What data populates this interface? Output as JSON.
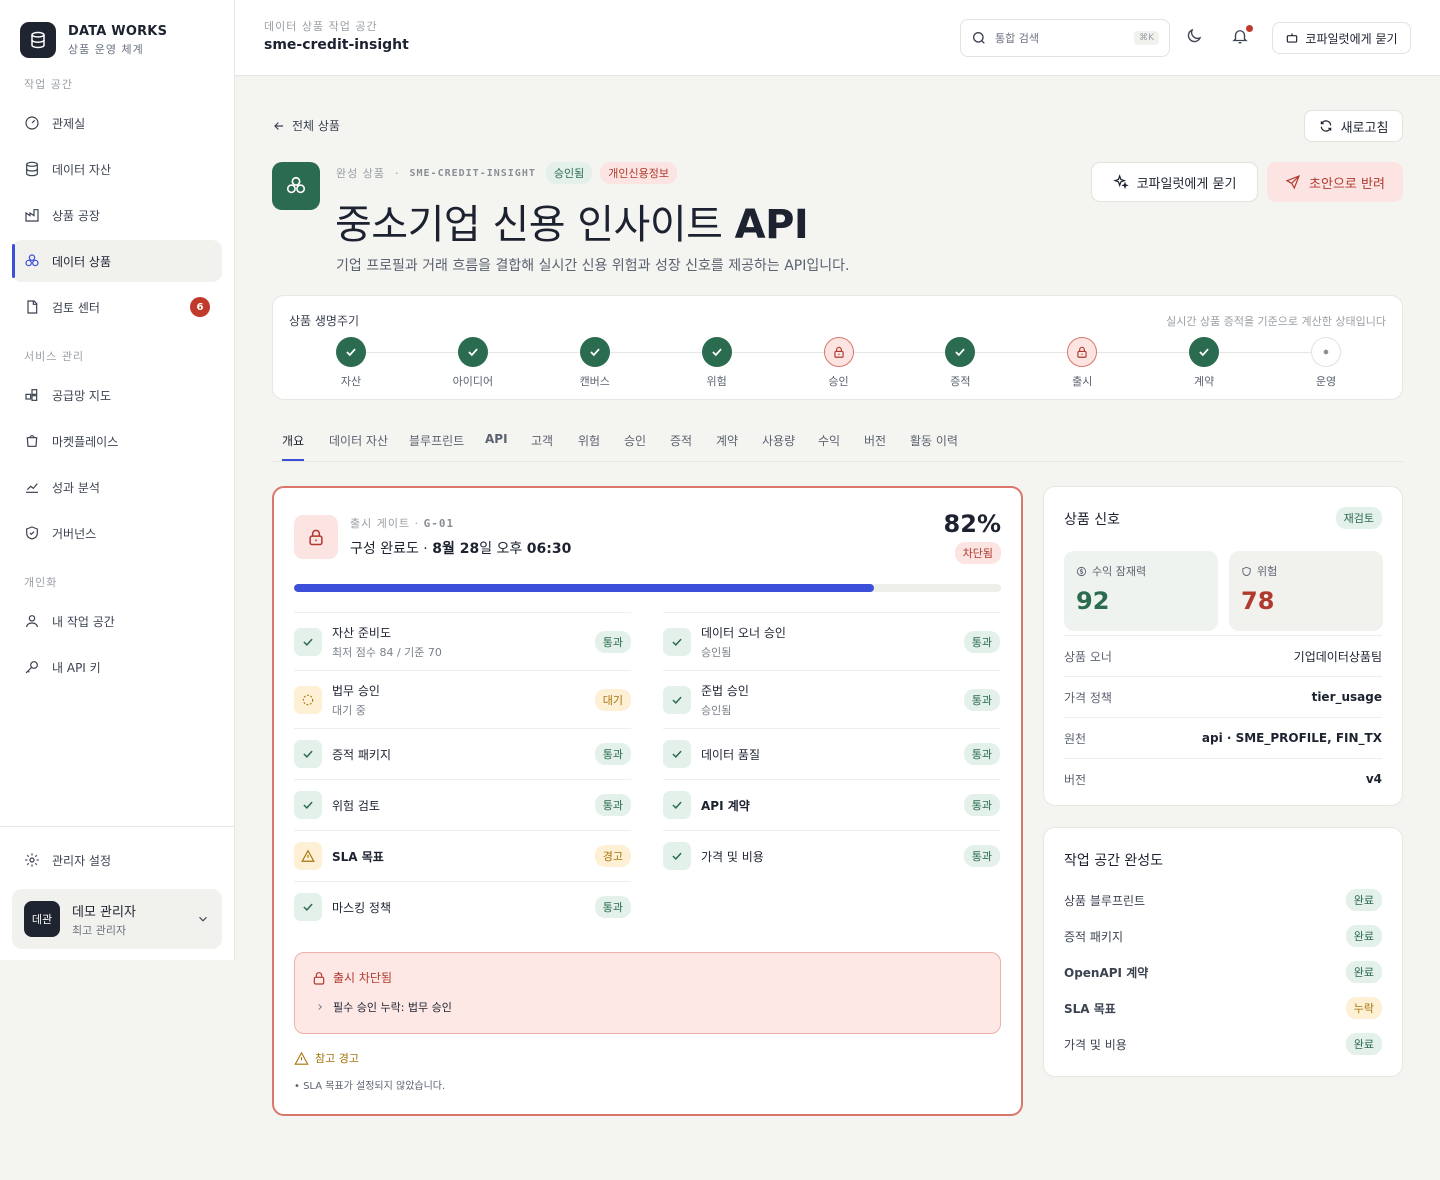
{
  "brand": {
    "name": "DATA WORKS",
    "subtitle": "상품 운영 체계"
  },
  "sidebar": {
    "section_workspace": "작업 공간",
    "section_service": "서비스 관리",
    "section_personal": "개인화",
    "items_workspace": [
      {
        "label": "관제실",
        "icon": "gauge-icon"
      },
      {
        "label": "데이터 자산",
        "icon": "database-icon"
      },
      {
        "label": "상품 공장",
        "icon": "factory-icon"
      },
      {
        "label": "데이터 상품",
        "icon": "product-icon",
        "active": true
      },
      {
        "label": "검토 센터",
        "icon": "document-icon",
        "badge": "6"
      }
    ],
    "items_service": [
      {
        "label": "공급망 지도",
        "icon": "supply-map-icon"
      },
      {
        "label": "마켓플레이스",
        "icon": "marketplace-icon"
      },
      {
        "label": "성과 분석",
        "icon": "chart-icon"
      },
      {
        "label": "거버넌스",
        "icon": "shield-icon"
      }
    ],
    "items_personal": [
      {
        "label": "내 작업 공간",
        "icon": "user-icon"
      },
      {
        "label": "내 API 키",
        "icon": "key-icon"
      }
    ],
    "settings_label": "관리자 설정",
    "user": {
      "avatar": "데관",
      "name": "데모 관리자",
      "role": "최고 관리자"
    }
  },
  "topbar": {
    "workspace_label": "데이터 상품 작업 공간",
    "workspace_name": "sme-credit-insight",
    "search_placeholder": "통합 검색",
    "search_shortcut": "⌘K",
    "copilot_label": "코파일럿에게 묻기"
  },
  "header": {
    "back_label": "전체 상품",
    "refresh_label": "새로고침",
    "meta_prefix": "완성 상품",
    "meta_sep": "·",
    "product_code": "SME-CREDIT-INSIGHT",
    "status_badge": "승인됨",
    "sensitivity_badge": "개인신용정보",
    "title_main": "중소기업 신용 인사이트",
    "title_bold": "API",
    "description": "기업 프로필과 거래 흐름을 결합해 실시간 신용 위험과 성장 신호를 제공하는 API입니다.",
    "copilot_button": "코파일럿에게 묻기",
    "return_button": "초안으로 반려"
  },
  "lifecycle": {
    "title": "상품 생명주기",
    "note": "실시간 상품 증적을 기준으로 계산한 상태입니다",
    "steps": [
      {
        "label": "자산",
        "state": "done"
      },
      {
        "label": "아이디어",
        "state": "done"
      },
      {
        "label": "캔버스",
        "state": "done"
      },
      {
        "label": "위험",
        "state": "done"
      },
      {
        "label": "승인",
        "state": "blocked"
      },
      {
        "label": "증적",
        "state": "done"
      },
      {
        "label": "출시",
        "state": "blocked"
      },
      {
        "label": "계약",
        "state": "done"
      },
      {
        "label": "운영",
        "state": "pending"
      }
    ]
  },
  "tabs": [
    "개요",
    "데이터 자산",
    "블루프린트",
    "API",
    "고객",
    "위험",
    "승인",
    "증적",
    "계약",
    "사용량",
    "수익",
    "버전",
    "활동 이력"
  ],
  "gate": {
    "label": "출시 게이트",
    "sep": "·",
    "code": "G-01",
    "status_prefix": "구성 완료도 ·",
    "status_date": "8월 28",
    "status_mid": "일 오후",
    "status_time": "06:30",
    "percent_label": "82%",
    "progress": 0.82,
    "blocked_badge": "차단됨",
    "checks_left": [
      {
        "name": "자산 준비도",
        "sub": "최저 점수 84 / 기준 70",
        "status": "통과",
        "kind": "ok"
      },
      {
        "name": "법무 승인",
        "sub": "대기 중",
        "status": "대기",
        "kind": "wait"
      },
      {
        "name": "증적 패키지",
        "sub": "",
        "status": "통과",
        "kind": "ok"
      },
      {
        "name": "위험 검토",
        "sub": "",
        "status": "통과",
        "kind": "ok"
      },
      {
        "name": "SLA 목표",
        "sub": "",
        "status": "경고",
        "kind": "warn"
      },
      {
        "name": "마스킹 정책",
        "sub": "",
        "status": "통과",
        "kind": "ok"
      }
    ],
    "checks_right": [
      {
        "name": "데이터 오너 승인",
        "sub": "승인됨",
        "status": "통과",
        "kind": "ok"
      },
      {
        "name": "준법 승인",
        "sub": "승인됨",
        "status": "통과",
        "kind": "ok"
      },
      {
        "name": "데이터 품질",
        "sub": "",
        "status": "통과",
        "kind": "ok"
      },
      {
        "name": "API 계약",
        "sub": "",
        "status": "통과",
        "kind": "ok"
      },
      {
        "name": "가격 및 비용",
        "sub": "",
        "status": "통과",
        "kind": "ok"
      }
    ],
    "alert_title": "출시 차단됨",
    "alert_item": "필수 승인 누락: 법무 승인",
    "warning_title": "참고 경고",
    "warning_item": "• SLA 목표가 설정되지 않았습니다."
  },
  "signals": {
    "title": "상품 신호",
    "badge": "재검토",
    "revenue_label": "수익 잠재력",
    "revenue_value": "92",
    "risk_label": "위험",
    "risk_value": "78",
    "rows": [
      {
        "key": "상품 오너",
        "value": "기업데이터상품팀",
        "bold": false
      },
      {
        "key": "가격 정책",
        "value": "tier_usage",
        "bold": true
      },
      {
        "key": "원천",
        "value": "api · SME_PROFILE, FIN_TX",
        "bold": true
      },
      {
        "key": "버전",
        "value": "v4",
        "bold": true
      }
    ]
  },
  "completeness": {
    "title": "작업 공간 완성도",
    "rows": [
      {
        "label": "상품 블루프린트",
        "status": "완료",
        "kind": "ok"
      },
      {
        "label": "증적 패키지",
        "status": "완료",
        "kind": "ok"
      },
      {
        "label": "OpenAPI 계약",
        "status": "완료",
        "kind": "ok"
      },
      {
        "label": "SLA 목표",
        "status": "누락",
        "kind": "warn"
      },
      {
        "label": "가격 및 비용",
        "status": "완료",
        "kind": "ok"
      }
    ]
  },
  "colors": {
    "accent": "#3b4fd9",
    "success": "#2b6b4f",
    "danger": "#b03a2e",
    "warning": "#a6740c"
  }
}
